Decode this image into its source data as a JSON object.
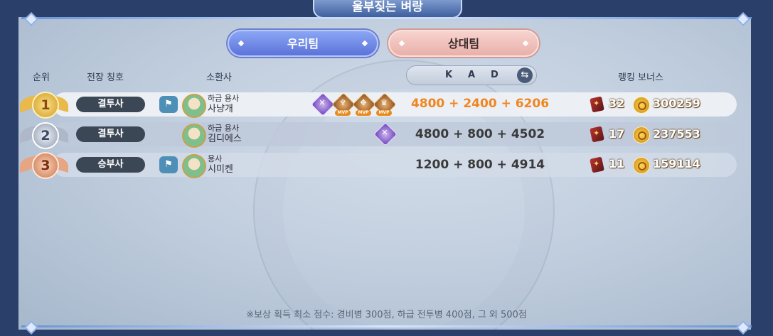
{
  "window": {
    "title": "울부짖는 벼랑"
  },
  "tabs": {
    "ours": "우리팀",
    "opponent": "상대팀"
  },
  "columns": {
    "rank": "순위",
    "title": "전장 칭호",
    "summoner": "소환사",
    "kad_k": "K",
    "kad_a": "A",
    "kad_d": "D",
    "bonus": "랭킹 보너스"
  },
  "rows": [
    {
      "rank": "1",
      "title": "결투사",
      "summoner_rank": "하급 용사",
      "summoner_name": "사냥개",
      "kad": "4800 + 2400 + 6206",
      "bonus_books": "32",
      "bonus_coins": "300259",
      "badge_count": 4,
      "highlight": true
    },
    {
      "rank": "2",
      "title": "결투사",
      "summoner_rank": "하급 용사",
      "summoner_name": "김디에스",
      "kad": "4800 + 800 + 4502",
      "bonus_books": "17",
      "bonus_coins": "237553",
      "badge_count": 1,
      "highlight": false
    },
    {
      "rank": "3",
      "title": "승부사",
      "summoner_rank": "용사",
      "summoner_name": "시미켄",
      "kad": "1200 + 800 + 4914",
      "bonus_books": "11",
      "bonus_coins": "159114",
      "badge_count": 0,
      "highlight": false
    }
  ],
  "badges": {
    "mvp_label": "MVP"
  },
  "icons": [
    "squad-icon",
    "avatar",
    "rank-medal-icon",
    "swap-icon",
    "book-icon",
    "coin-icon"
  ],
  "footer": "※보상 획득 최소 점수: 경비병 300점, 하급 전투병 400점, 그 외 500점",
  "colors": {
    "highlight": "#f08620",
    "tab_ours": "#6f86e6",
    "tab_opponent": "#eebcb6"
  }
}
